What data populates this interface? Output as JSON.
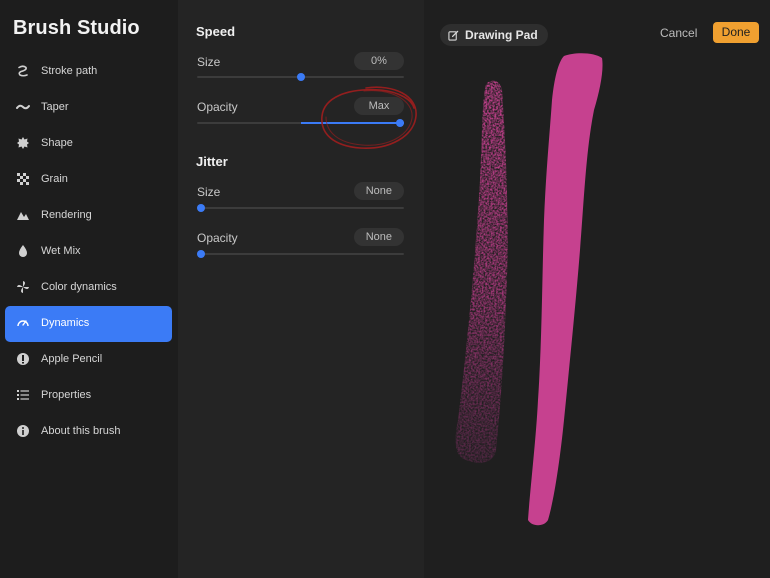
{
  "app": {
    "title": "Brush Studio"
  },
  "sidebar": {
    "items": [
      {
        "label": "Stroke path",
        "icon": "stroke-path-icon",
        "active": false
      },
      {
        "label": "Taper",
        "icon": "taper-icon",
        "active": false
      },
      {
        "label": "Shape",
        "icon": "shape-icon",
        "active": false
      },
      {
        "label": "Grain",
        "icon": "grain-icon",
        "active": false
      },
      {
        "label": "Rendering",
        "icon": "rendering-icon",
        "active": false
      },
      {
        "label": "Wet Mix",
        "icon": "wet-mix-icon",
        "active": false
      },
      {
        "label": "Color dynamics",
        "icon": "color-dynamics-icon",
        "active": false
      },
      {
        "label": "Dynamics",
        "icon": "dynamics-icon",
        "active": true
      },
      {
        "label": "Apple Pencil",
        "icon": "apple-pencil-icon",
        "active": false
      },
      {
        "label": "Properties",
        "icon": "properties-icon",
        "active": false
      },
      {
        "label": "About this brush",
        "icon": "info-icon",
        "active": false
      }
    ]
  },
  "settings": {
    "speed": {
      "title": "Speed",
      "size": {
        "label": "Size",
        "value": "0%",
        "level": 0.5
      },
      "opacity": {
        "label": "Opacity",
        "value": "Max",
        "level": 1.0
      }
    },
    "jitter": {
      "title": "Jitter",
      "size": {
        "label": "Size",
        "value": "None",
        "level": 0
      },
      "opacity": {
        "label": "Opacity",
        "value": "None",
        "level": 0
      }
    }
  },
  "pad": {
    "title": "Drawing Pad",
    "cancel_label": "Cancel",
    "done_label": "Done",
    "stroke_color": "#c6418f"
  },
  "colors": {
    "accent": "#3b7bf6",
    "done": "#f0a030",
    "annotation": "#a01e1e"
  }
}
